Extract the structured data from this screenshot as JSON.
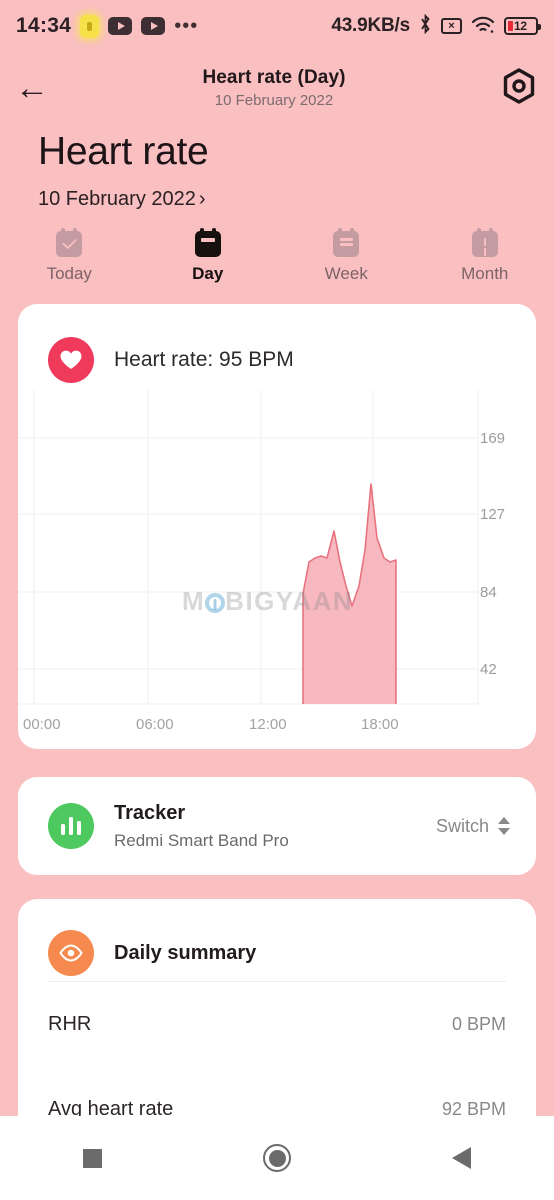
{
  "status_bar": {
    "time": "14:34",
    "network_speed": "43.9KB/s",
    "battery_level": "12",
    "icons": [
      "lock-icon",
      "youtube-icon",
      "youtube-icon",
      "more-dots-icon",
      "bluetooth-icon",
      "mute-icon",
      "wifi-icon",
      "battery-icon"
    ],
    "bluetooth_glyph": "ᛦ",
    "mute_glyph": "×",
    "wifi_glyph": "◠",
    "dots_glyph": "•••"
  },
  "app_bar": {
    "back_glyph": "←",
    "title": "Heart rate (Day)",
    "subtitle": "10 February 2022",
    "settings_icon": "hexagon-settings-icon"
  },
  "page": {
    "title": "Heart rate",
    "date": "10 February 2022",
    "date_chevron": "›"
  },
  "tabs": [
    {
      "label": "Today",
      "icon": "calendar-check-icon",
      "active": false
    },
    {
      "label": "Day",
      "icon": "calendar-day-icon",
      "active": true
    },
    {
      "label": "Week",
      "icon": "calendar-week-icon",
      "active": false
    },
    {
      "label": "Month",
      "icon": "calendar-month-icon",
      "active": false
    }
  ],
  "heart_rate_card": {
    "icon": "heart-icon",
    "summary_text": "Heart rate: 95 BPM",
    "accent_color": "#f03a5c",
    "watermark": "M BIGYAAN"
  },
  "tracker_card": {
    "icon": "bar-chart-icon",
    "title": "Tracker",
    "device": "Redmi Smart Band Pro",
    "switch_label": "Switch",
    "switch_icon": "up-down-chevron-icon",
    "accent_color": "#4ec95f"
  },
  "daily_summary_card": {
    "icon": "eye-icon",
    "title": "Daily summary",
    "accent_color": "#f5894e",
    "rows": [
      {
        "label": "RHR",
        "value": "0 BPM"
      },
      {
        "label": "Avg heart rate",
        "value": "92 BPM"
      }
    ]
  },
  "nav_bar": {
    "recents": "recents-button",
    "home": "home-button",
    "back": "back-button"
  },
  "chart_data": {
    "type": "area",
    "title": "Heart rate (Day)",
    "xlabel": "",
    "ylabel": "BPM",
    "grid": true,
    "legend": null,
    "line_color": "#e8737f",
    "fill_color": "#f7b9bf",
    "y_ticks": [
      42,
      84,
      127,
      169
    ],
    "ylim": [
      0,
      190
    ],
    "x_ticks": [
      "00:00",
      "06:00",
      "12:00",
      "18:00"
    ],
    "xlim": [
      "00:00",
      "24:00"
    ],
    "x": [
      "14:00",
      "14:20",
      "14:40",
      "15:00",
      "15:20",
      "15:40",
      "16:00",
      "16:20",
      "16:40",
      "17:00",
      "17:20",
      "17:40",
      "18:00",
      "18:20",
      "18:40",
      "19:00",
      "19:20",
      "19:30"
    ],
    "values": [
      0,
      62,
      88,
      92,
      90,
      89,
      105,
      88,
      72,
      60,
      72,
      95,
      140,
      112,
      99,
      95,
      97,
      0
    ]
  }
}
